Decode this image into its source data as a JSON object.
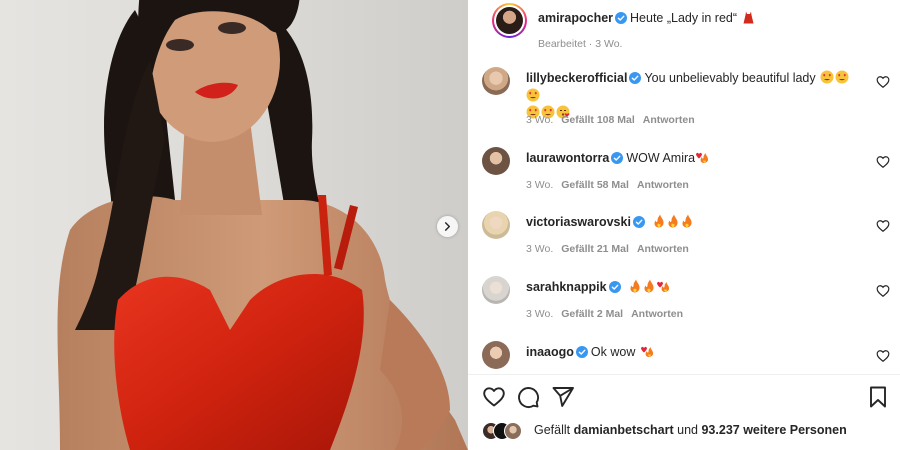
{
  "post": {
    "author": "amirapocher",
    "caption": "Heute „Lady in red“",
    "caption_emoji": "dress-emoji",
    "edited": "Bearbeitet",
    "age": "3 Wo."
  },
  "comments": [
    {
      "user": "lillybeckerofficial",
      "text": "You unbelievably beautiful lady",
      "age": "3 Wo.",
      "likes": "Gefällt 108 Mal",
      "reply": "Antworten"
    },
    {
      "user": "laurawontorra",
      "text": "WOW Amira",
      "age": "3 Wo.",
      "likes": "Gefällt 58 Mal",
      "reply": "Antworten"
    },
    {
      "user": "victoriaswarovski",
      "text": "",
      "age": "3 Wo.",
      "likes": "Gefällt 21 Mal",
      "reply": "Antworten"
    },
    {
      "user": "sarahknappik",
      "text": "",
      "age": "3 Wo.",
      "likes": "Gefällt 2 Mal",
      "reply": "Antworten"
    },
    {
      "user": "inaaogo",
      "text": "Ok wow"
    }
  ],
  "likes": {
    "prefix": "Gefällt",
    "user": "damianbetschart",
    "middle": "und",
    "count": "93.237 weitere Personen"
  },
  "icons": {
    "verified": "verified-badge-icon",
    "like": "heart-icon",
    "comment": "comment-icon",
    "share": "paper-plane-icon",
    "save": "bookmark-icon",
    "next": "chevron-right-icon"
  },
  "colors": {
    "verified": "#3897f0",
    "dress": "#d8281a",
    "meta_text": "#8e8e8e"
  }
}
